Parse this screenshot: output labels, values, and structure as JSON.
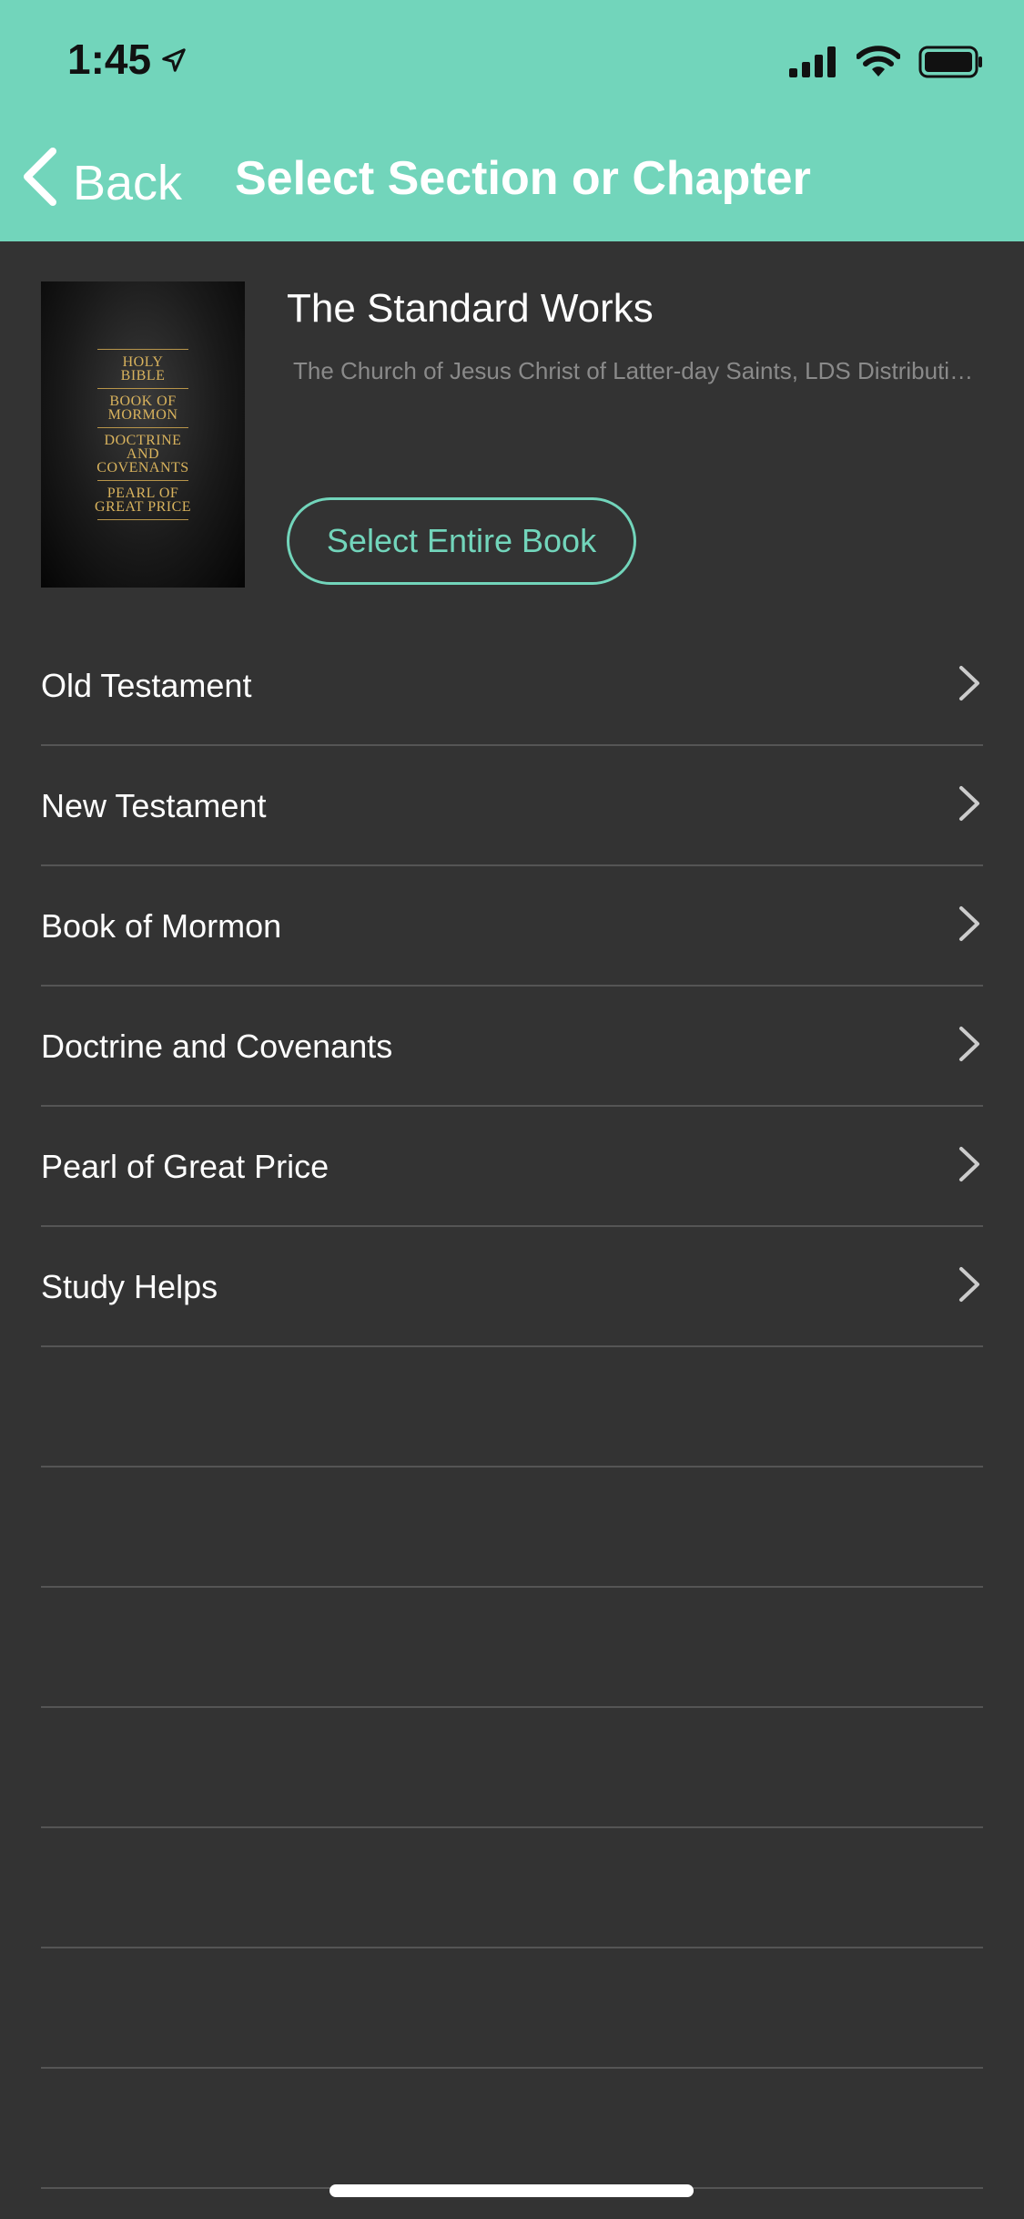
{
  "status_bar": {
    "time": "1:45",
    "icons": [
      "location-arrow-icon",
      "cellular-signal-icon",
      "wifi-icon",
      "battery-icon"
    ]
  },
  "nav": {
    "back_label": "Back",
    "title": "Select Section or Chapter"
  },
  "book": {
    "title": "The Standard Works",
    "author": "The Church of Jesus Christ of Latter-day Saints, LDS Distribution Services",
    "cover_lines": [
      "HOLY BIBLE",
      "BOOK OF MORMON",
      "DOCTRINE AND COVENANTS",
      "PEARL OF GREAT PRICE"
    ],
    "select_label": "Select Entire Book"
  },
  "sections": [
    {
      "label": "Old Testament"
    },
    {
      "label": "New Testament"
    },
    {
      "label": "Book of Mormon"
    },
    {
      "label": "Doctrine and Covenants"
    },
    {
      "label": "Pearl of Great Price"
    },
    {
      "label": "Study Helps"
    }
  ],
  "colors": {
    "accent": "#72d5bb",
    "background": "#333333",
    "divider": "#555555"
  }
}
